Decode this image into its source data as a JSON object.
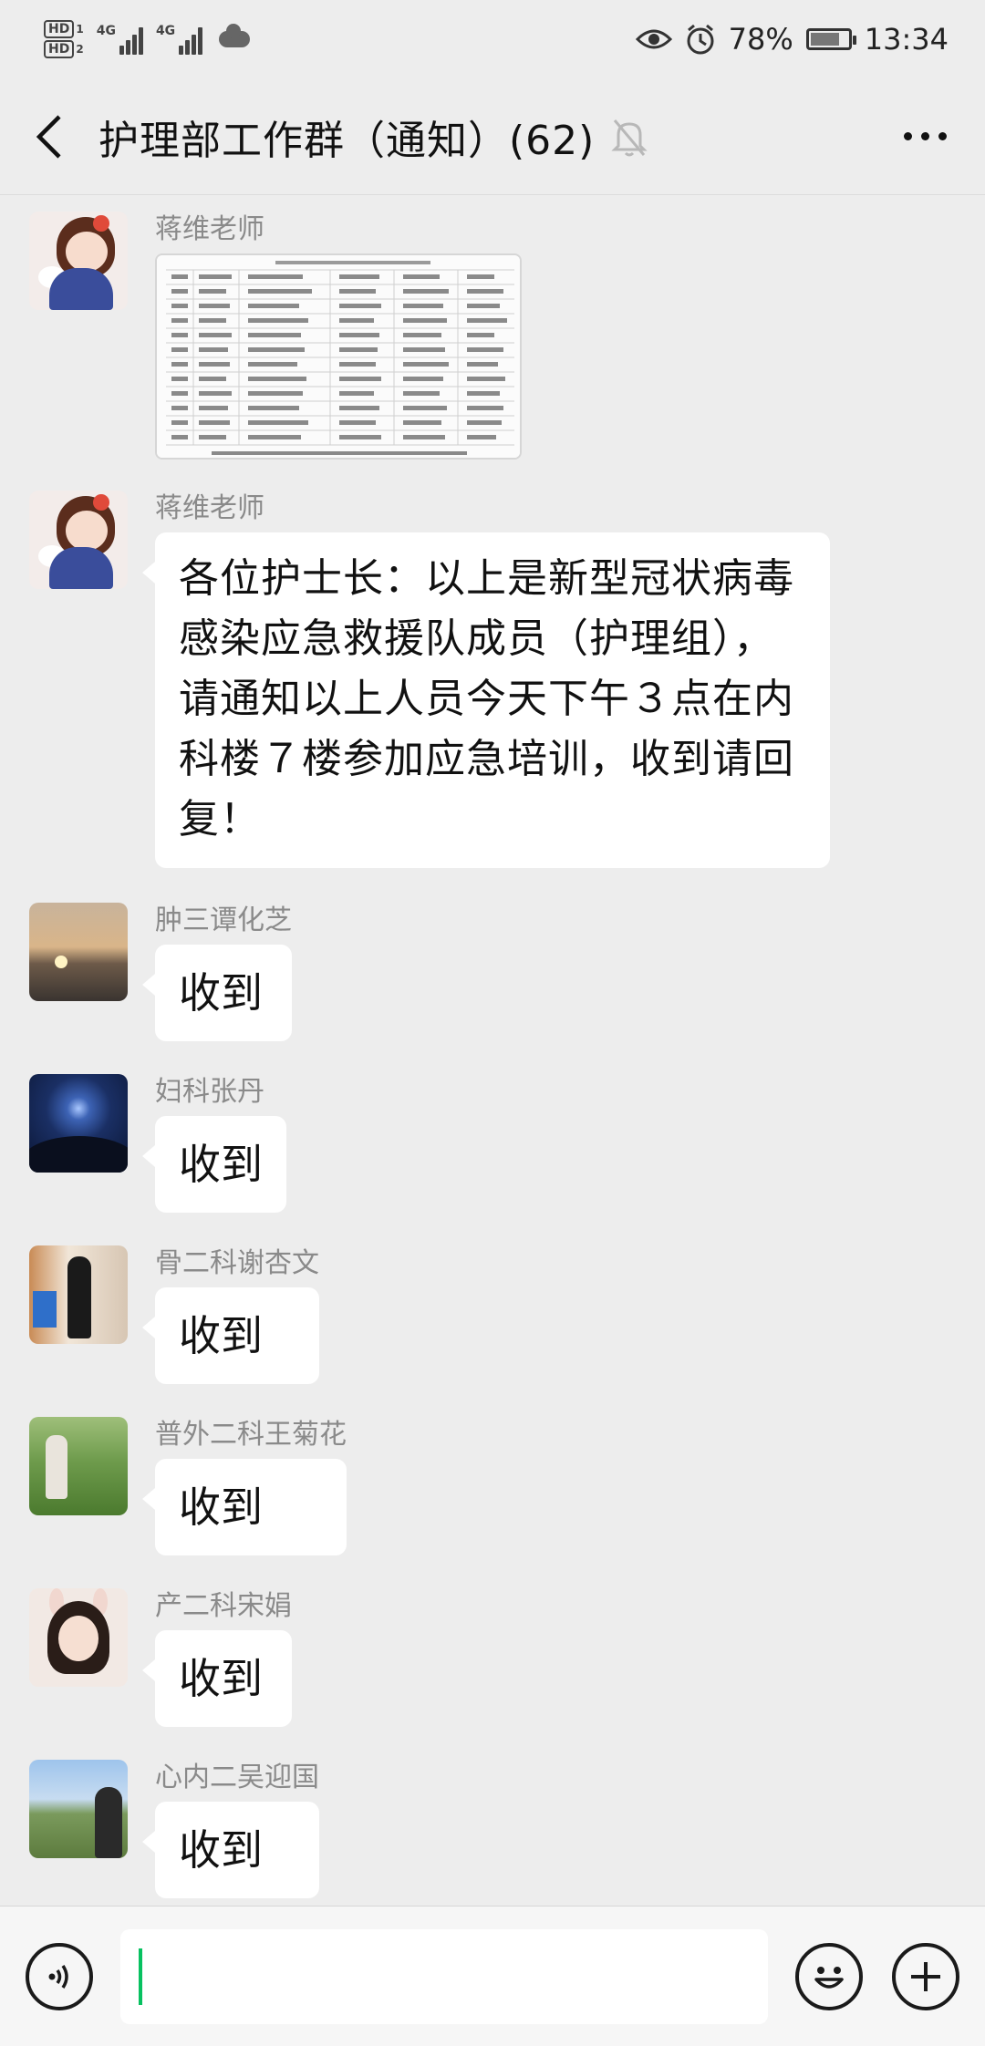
{
  "status_bar": {
    "hd1": "HD",
    "hd1_sub": "1",
    "hd2": "HD",
    "hd2_sub": "2",
    "net1": "4G",
    "net2": "4G",
    "battery_percent": "78%",
    "battery_level": 0.78,
    "time": "13:34"
  },
  "header": {
    "title": "护理部工作群（通知）(62)"
  },
  "messages": [
    {
      "sender": "蒋维老师",
      "type": "image"
    },
    {
      "sender": "蒋维老师",
      "type": "text",
      "text": "各位护士长：以上是新型冠状病毒感染应急救援队成员（护理组），请通知以上人员今天下午３点在内科楼７楼参加应急培训，收到请回复！"
    },
    {
      "sender": "肿三谭化芝",
      "type": "text",
      "text": "收到"
    },
    {
      "sender": "妇科张丹",
      "type": "text",
      "text": "收到"
    },
    {
      "sender": "骨二科谢杏文",
      "type": "text",
      "text": "收到"
    },
    {
      "sender": "普外二科王菊花",
      "type": "text",
      "text": "收到"
    },
    {
      "sender": "产二科宋娟",
      "type": "text",
      "text": "收到"
    },
    {
      "sender": "心内二吴迎国",
      "type": "text",
      "text": "收到"
    }
  ],
  "icons": {
    "back": "chevron-left-icon",
    "mute": "bell-muted-icon",
    "more": "more-dots-icon",
    "voice": "voice-icon",
    "emoji": "emoji-icon",
    "add": "plus-icon"
  },
  "colors": {
    "background": "#ededed",
    "bubble": "#ffffff",
    "caret": "#07c160"
  }
}
